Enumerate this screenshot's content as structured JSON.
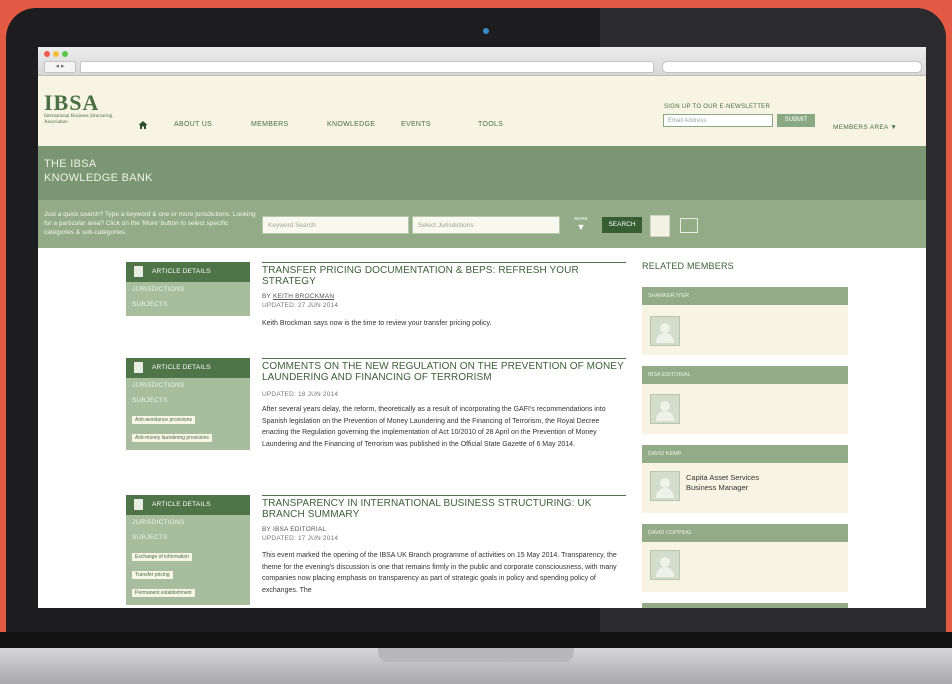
{
  "header": {
    "logo_text": "IBSA",
    "logo_subtitle": "International Business Structuring Association",
    "nav": [
      "ABOUT US",
      "MEMBERS",
      "KNOWLEDGE",
      "EVENTS",
      "TOOLS"
    ],
    "newsletter_label": "SIGN UP TO OUR E-NEWSLETTER",
    "email_placeholder": "Email Address",
    "submit_label": "SUBMIT",
    "members_area": "MEMBERS AREA ▼"
  },
  "banner": {
    "line1": "THE IBSA",
    "line2": "KNOWLEDGE BANK"
  },
  "search": {
    "help": "Just a quick search? Type a keyword & one or more jurisdictions. Looking for a particular area? Click on the 'More' button to select specific categories & sub-categories.",
    "keyword_placeholder": "Keyword Search",
    "jurisdiction_placeholder": "Select Jurisdictions",
    "more_label": "MORE",
    "search_label": "SEARCH"
  },
  "articles": [
    {
      "details": "ARTICLE DETAILS",
      "jurisdictions": "JURISDICTIONS",
      "subjects": "SUBJECTS",
      "tags": [],
      "title": "TRANSFER PRICING DOCUMENTATION & BEPS: REFRESH YOUR STRATEGY",
      "by_prefix": "BY ",
      "author": "KEITH BROCKMAN",
      "updated": "UPDATED: 27 JUN 2014",
      "text": "Keith Brockman says now is the time to review your transfer pricing policy."
    },
    {
      "details": "ARTICLE DETAILS",
      "jurisdictions": "JURISDICTIONS",
      "subjects": "SUBJECTS",
      "tags": [
        "Anti-avoidance provisions",
        "Anti-money laundering provisions"
      ],
      "title": "COMMENTS ON THE NEW REGULATION ON THE PREVENTION OF MONEY LAUNDERING AND FINANCING OF TERRORISM",
      "updated": "UPDATED: 18 JUN 2014",
      "text": "After several years delay, the reform, theoretically as a result of incorporating the GAFI's recommendations into Spanish legislation on the Prevention of Money Laundering and the Financing of Terrorism, the Royal Decree enacting the Regulation governing the implementation of Act 10/2010 of 28 April on the Prevention of Money Laundering and the Financing of Terrorism was published in the Official State Gazette of 6 May 2014."
    },
    {
      "details": "ARTICLE DETAILS",
      "jurisdictions": "JURISDICTIONS",
      "subjects": "SUBJECTS",
      "tags": [
        "Exchange of information",
        "Transfer pricing",
        "Permanent establishment"
      ],
      "title": "TRANSPARENCY IN INTERNATIONAL BUSINESS STRUCTURING: UK BRANCH SUMMARY",
      "author_plain": "BY IBSA EDITORIAL",
      "updated": "UPDATED: 17 JUN 2014",
      "text": "This event marked the opening of the IBSA UK Branch programme of activities on 15 May 2014. Transparency, the theme for the evening's discussion is one that remains firmly in the public and corporate consciousness, with many companies now placing emphasis on transparency as part of strategic goals in policy and spending policy of exchanges. The"
    }
  ],
  "related": {
    "title": "RELATED MEMBERS",
    "members": [
      {
        "name": "SHANKER IYER",
        "line1": "",
        "line2": ""
      },
      {
        "name": "IBSA EDITORIAL",
        "line1": "",
        "line2": ""
      },
      {
        "name": "DAVID KEMP",
        "line1": "Capita Asset Services",
        "line2": "Business Manager"
      },
      {
        "name": "DAVID COPPING",
        "line1": "",
        "line2": ""
      }
    ]
  },
  "colors": {
    "accent": "#4f7448",
    "banner": "#7a9672",
    "search_bar": "#93ab87",
    "header_bg": "#f7f4e3"
  }
}
